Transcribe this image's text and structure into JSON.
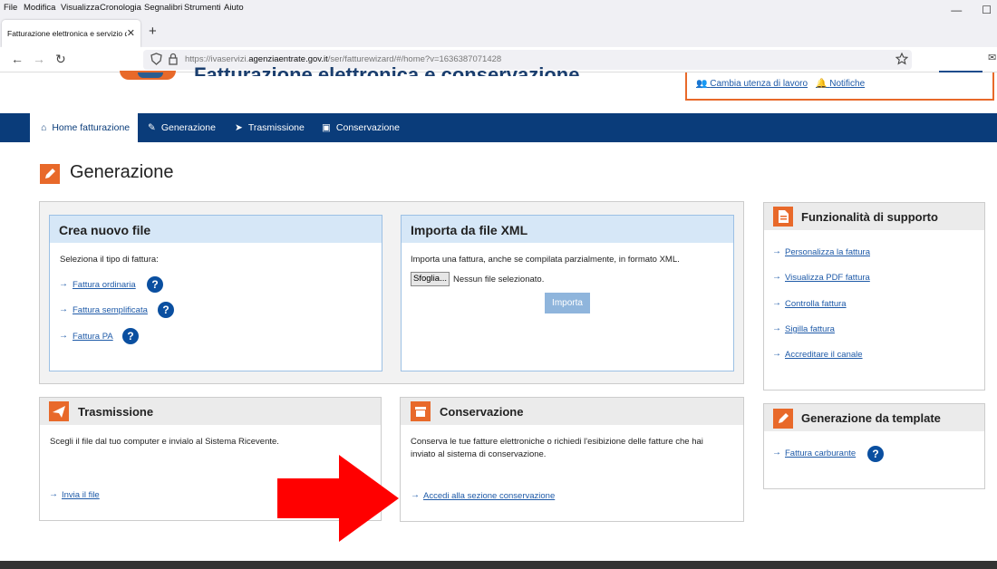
{
  "menubar": [
    "File",
    "Modifica",
    "Visualizza",
    "Cronologia",
    "Segnalibri",
    "Strumenti",
    "Aiuto"
  ],
  "tab_title": "Fatturazione elettronica e servizio di",
  "url": {
    "prefix": "https://ivaservizi.",
    "domain": "agenziaentrate.gov.it",
    "suffix": "/ser/fatturewizard/#/home?v=1636387071428"
  },
  "header": {
    "title": "Fatturazione elettronica e conservazione",
    "cambia": "Cambia utenza di lavoro",
    "notifiche": "Notifiche"
  },
  "nav": [
    "Home fatturazione",
    "Generazione",
    "Trasmissione",
    "Conservazione"
  ],
  "page_title": "Generazione",
  "crea": {
    "title": "Crea nuovo file",
    "desc": "Seleziona il tipo di fattura:",
    "links": [
      "Fattura ordinaria",
      "Fattura semplificata",
      "Fattura PA"
    ]
  },
  "importa": {
    "title": "Importa da file XML",
    "desc": "Importa una fattura, anche se compilata parzialmente, in formato XML.",
    "browse": "Sfoglia...",
    "nofile": "Nessun file selezionato.",
    "button": "Importa"
  },
  "trasmissione": {
    "title": "Trasmissione",
    "desc": "Scegli il file dal tuo computer e invialo al Sistema Ricevente.",
    "link": "Invia il file"
  },
  "conservazione": {
    "title": "Conservazione",
    "desc1": "Conserva le tue fatture elettroniche o richiedi l'esibizione delle fatture che hai",
    "desc2": "inviato al sistema di conservazione.",
    "link": "Accedi alla sezione conservazione"
  },
  "supporto": {
    "title": "Funzionalità di supporto",
    "links": [
      "Personalizza la fattura",
      "Visualizza PDF fattura",
      "Controlla fattura",
      "Sigilla fattura",
      "Accreditare il canale"
    ]
  },
  "template": {
    "title": "Generazione da template",
    "link": "Fattura carburante"
  },
  "colors": {
    "accent": "#e8692a",
    "nav": "#0a3c7a",
    "link": "#1e5aa8",
    "arrow": "#ff0000"
  }
}
